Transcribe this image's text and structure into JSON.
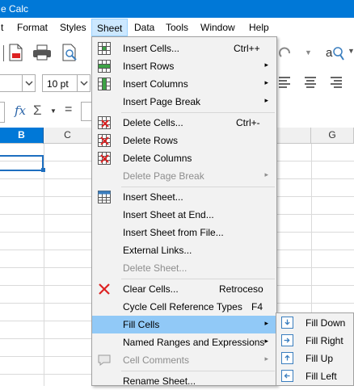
{
  "window": {
    "title": "e Calc"
  },
  "menubar": {
    "items": [
      "t",
      "Format",
      "Styles",
      "Sheet",
      "Data",
      "Tools",
      "Window",
      "Help"
    ],
    "active": "Sheet"
  },
  "format": {
    "font_size": "10 pt"
  },
  "formula": {
    "fx": "fx",
    "sigma": "Σ",
    "equals": "="
  },
  "columns": {
    "b": "B",
    "c": "C",
    "g": "G"
  },
  "sheet_menu": {
    "items": [
      {
        "label": "Insert Cells...",
        "shortcut": "Ctrl++"
      },
      {
        "label": "Insert Rows",
        "submenu": "▸"
      },
      {
        "label": "Insert Columns",
        "submenu": "▸"
      },
      {
        "label": "Insert Page Break",
        "submenu": "▸"
      },
      {
        "label": "Delete Cells...",
        "shortcut": "Ctrl+-"
      },
      {
        "label": "Delete Rows"
      },
      {
        "label": "Delete Columns"
      },
      {
        "label": "Delete Page Break",
        "submenu": "▸"
      },
      {
        "label": "Insert Sheet..."
      },
      {
        "label": "Insert Sheet at End..."
      },
      {
        "label": "Insert Sheet from File..."
      },
      {
        "label": "External Links..."
      },
      {
        "label": "Delete Sheet..."
      },
      {
        "label": "Clear Cells...",
        "shortcut": "Retroceso"
      },
      {
        "label": "Cycle Cell Reference Types",
        "shortcut": "F4"
      },
      {
        "label": "Fill Cells",
        "submenu": "▸"
      },
      {
        "label": "Named Ranges and Expressions",
        "submenu": "▸"
      },
      {
        "label": "Cell Comments",
        "submenu": "▸"
      },
      {
        "label": "Rename Sheet..."
      }
    ]
  },
  "fill_submenu": {
    "items": [
      "Fill Down",
      "Fill Right",
      "Fill Up",
      "Fill Left"
    ]
  },
  "colors": {
    "titlebar": "#0078d7",
    "highlight": "#91c9f7",
    "disabled_text": "#8d8d8d",
    "selected_cell_border": "#1e6fc0"
  }
}
